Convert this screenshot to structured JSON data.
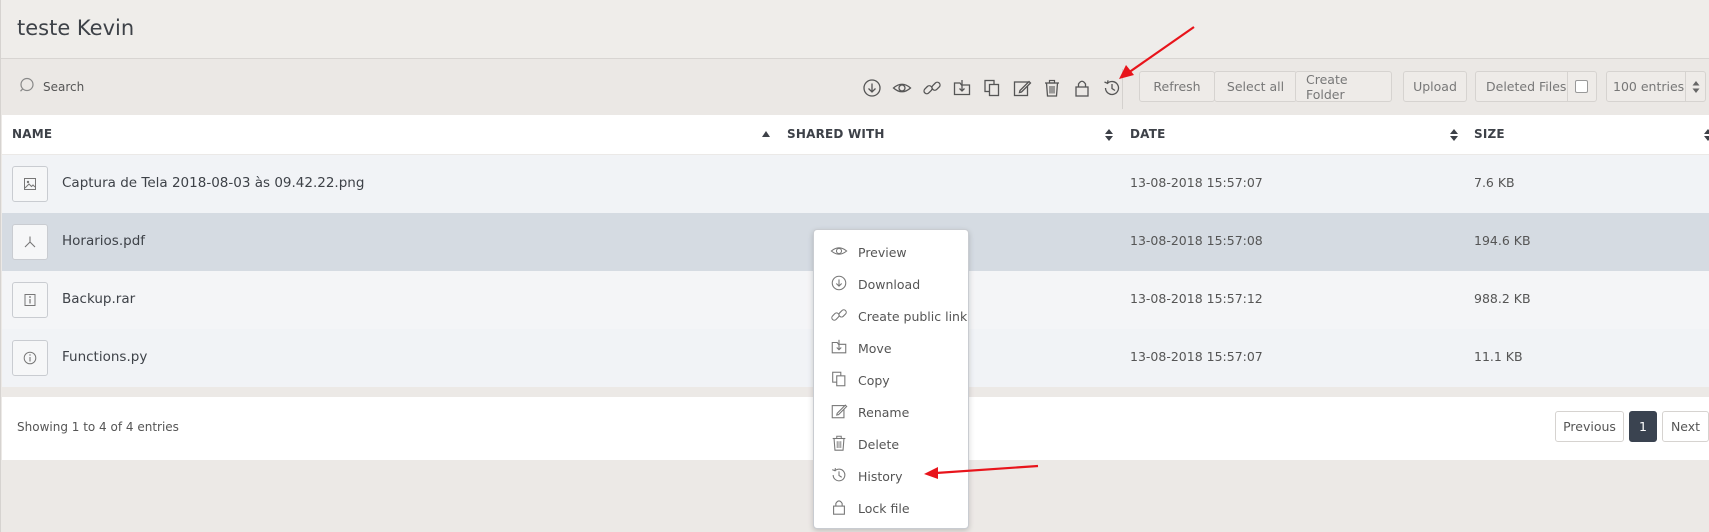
{
  "header": {
    "title": "teste Kevin"
  },
  "toolbar": {
    "search_label": "Search",
    "icons": [
      "download-icon",
      "eye-icon",
      "link-icon",
      "move-icon",
      "copy-icon",
      "edit-icon",
      "trash-icon",
      "lock-icon",
      "history-icon"
    ],
    "buttons": {
      "refresh": "Refresh",
      "select_all": "Select all",
      "create_folder": "Create Folder",
      "upload": "Upload",
      "deleted_files": "Deleted Files",
      "entries": "100 entries"
    }
  },
  "table": {
    "columns": [
      "NAME",
      "SHARED WITH",
      "DATE",
      "SIZE"
    ],
    "rows": [
      {
        "name": "Captura de Tela 2018-08-03 às 09.42.22.png",
        "shared": "",
        "date": "13-08-2018 15:57:07",
        "size": "7.6 KB",
        "icon": "image-file-icon"
      },
      {
        "name": "Horarios.pdf",
        "shared": "",
        "date": "13-08-2018 15:57:08",
        "size": "194.6 KB",
        "icon": "pdf-file-icon"
      },
      {
        "name": "Backup.rar",
        "shared": "",
        "date": "13-08-2018 15:57:12",
        "size": "988.2 KB",
        "icon": "archive-file-icon"
      },
      {
        "name": "Functions.py",
        "shared": "",
        "date": "13-08-2018 15:57:07",
        "size": "11.1 KB",
        "icon": "info-file-icon"
      }
    ]
  },
  "footer": {
    "info": "Showing 1 to 4 of 4 entries",
    "previous": "Previous",
    "page": "1",
    "next": "Next"
  },
  "context_menu": {
    "items": [
      "Preview",
      "Download",
      "Create public link",
      "Move",
      "Copy",
      "Rename",
      "Delete",
      "History",
      "Lock file"
    ]
  },
  "colors": {
    "selected_row": "#d5dbe2",
    "annotation_arrow": "#e8141b",
    "active_page": "#3a4350"
  }
}
